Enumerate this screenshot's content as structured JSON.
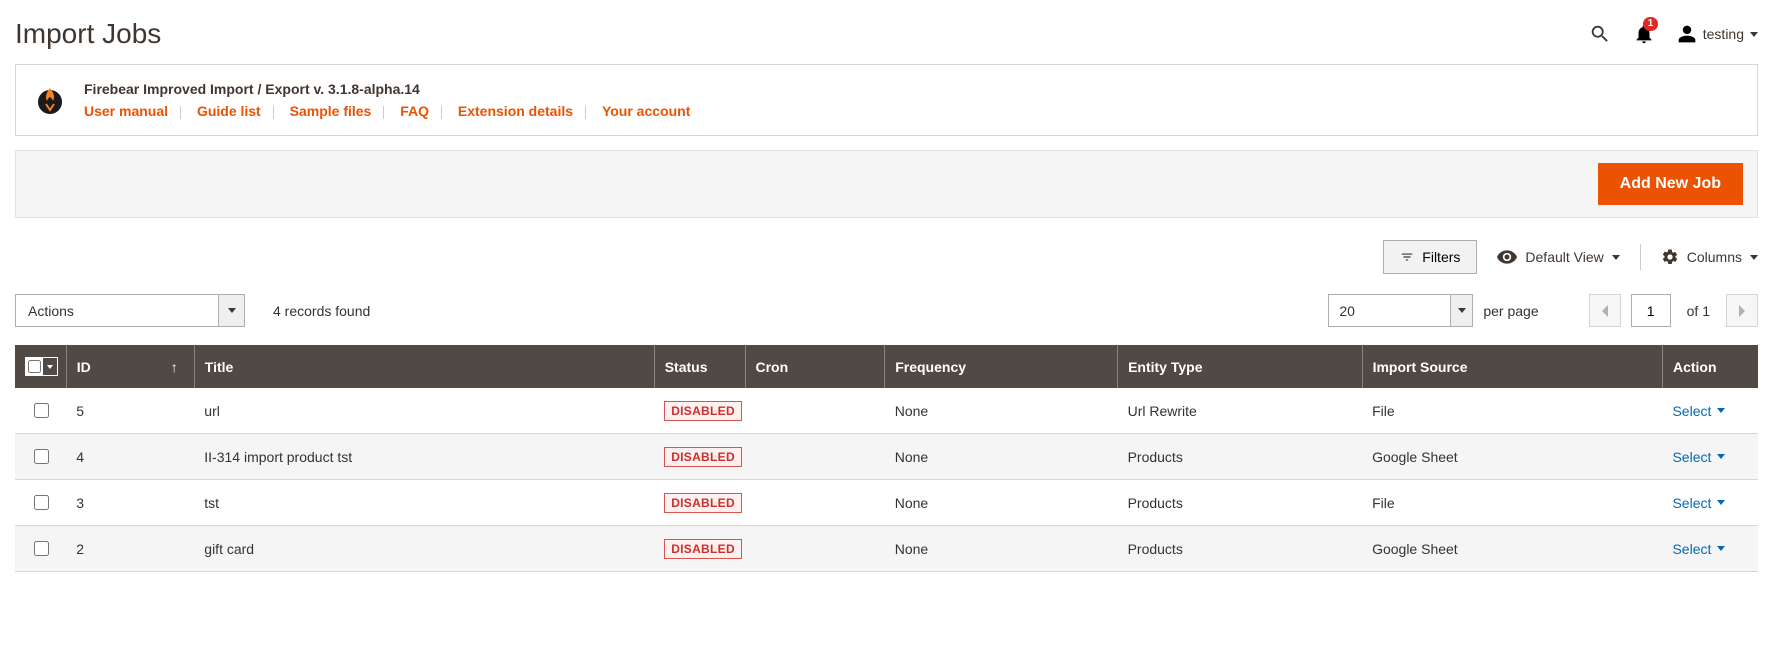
{
  "header": {
    "title": "Import Jobs",
    "notification_count": "1",
    "username": "testing"
  },
  "info": {
    "brand": "Firebear Improved Import / Export v. 3.1.8-alpha.14",
    "links": {
      "manual": "User manual",
      "guide": "Guide list",
      "samples": "Sample files",
      "faq": "FAQ",
      "ext": "Extension details",
      "account": "Your account"
    }
  },
  "actions": {
    "add_new": "Add New Job"
  },
  "toolbar": {
    "filters": "Filters",
    "default_view": "Default View",
    "columns": "Columns"
  },
  "grid_controls": {
    "actions_label": "Actions",
    "records_found": "4 records found",
    "page_size": "20",
    "per_page": "per page",
    "current_page": "1",
    "of_pages": "of 1"
  },
  "columns": {
    "id": "ID",
    "title": "Title",
    "status": "Status",
    "cron": "Cron",
    "frequency": "Frequency",
    "entity": "Entity Type",
    "source": "Import Source",
    "action": "Action"
  },
  "rows": [
    {
      "id": "5",
      "title": "url",
      "status": "DISABLED",
      "cron": "",
      "frequency": "None",
      "entity": "Url Rewrite",
      "source": "File",
      "action": "Select"
    },
    {
      "id": "4",
      "title": "II-314 import product tst",
      "status": "DISABLED",
      "cron": "",
      "frequency": "None",
      "entity": "Products",
      "source": "Google Sheet",
      "action": "Select"
    },
    {
      "id": "3",
      "title": "tst",
      "status": "DISABLED",
      "cron": "",
      "frequency": "None",
      "entity": "Products",
      "source": "File",
      "action": "Select"
    },
    {
      "id": "2",
      "title": "gift card",
      "status": "DISABLED",
      "cron": "",
      "frequency": "None",
      "entity": "Products",
      "source": "Google Sheet",
      "action": "Select"
    }
  ]
}
